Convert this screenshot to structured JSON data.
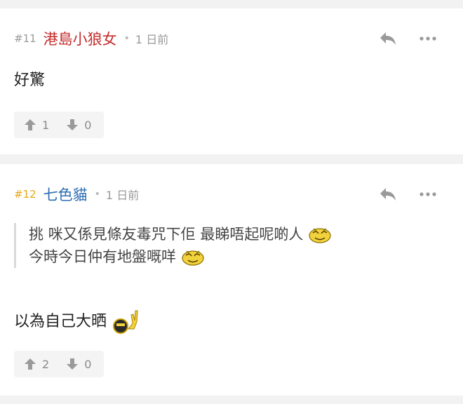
{
  "comments": [
    {
      "floor": "#11",
      "username": "港島小狼女",
      "time": "1 日前",
      "body": "好驚",
      "upvotes": "1",
      "downvotes": "0"
    },
    {
      "floor": "#12",
      "username": "七色貓",
      "time": "1 日前",
      "quote_line1": "挑 咪又係見條友毒咒下佢 最睇唔起呢啲人",
      "quote_line2": "今時今日仲有地盤嘅咩",
      "body": "以為自己大晒",
      "upvotes": "2",
      "downvotes": "0"
    }
  ],
  "separator": "•",
  "colors": {
    "background": "#f2f2f2",
    "card": "#ffffff",
    "username_red": "#c62b2b",
    "username_blue": "#2e6db4",
    "op_floor": "#e6a817",
    "meta_gray": "#9a9a9a"
  },
  "icons": {
    "reply": "reply-arrow-icon",
    "more": "more-horizontal-icon",
    "upvote": "arrow-up-icon",
    "downvote": "arrow-down-icon"
  }
}
